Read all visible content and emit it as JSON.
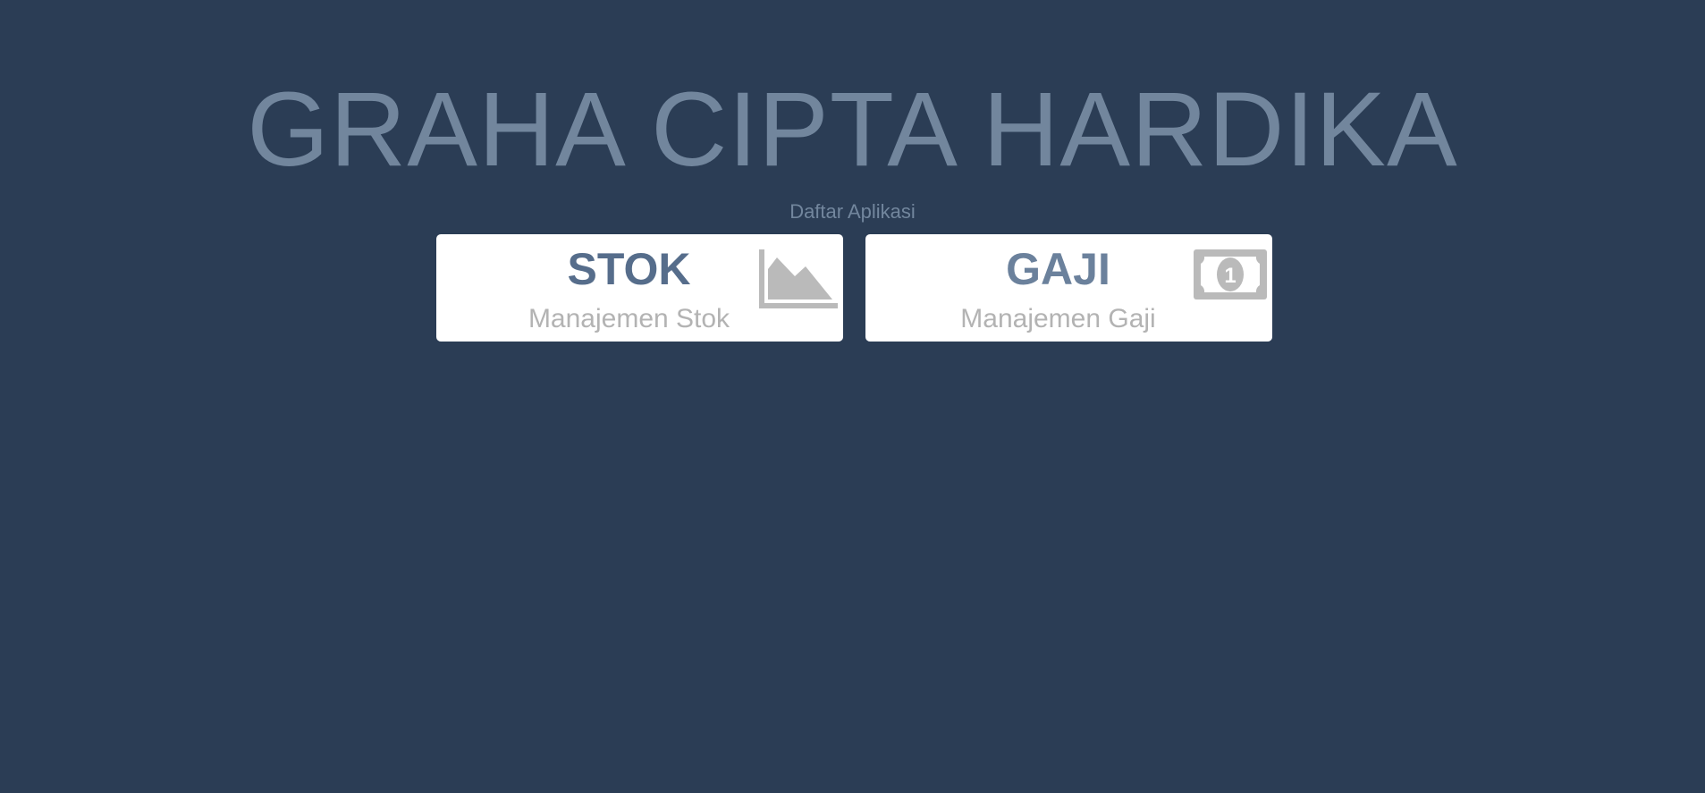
{
  "header": {
    "title": "GRAHA CIPTA HARDIKA",
    "subtitle": "Daftar Aplikasi"
  },
  "apps": [
    {
      "title": "STOK",
      "description": "Manajemen Stok",
      "icon": "area-chart-icon"
    },
    {
      "title": "GAJI",
      "description": "Manajemen Gaji",
      "icon": "money-bill-icon"
    }
  ],
  "colors": {
    "background": "#2b3d55",
    "title": "#72869d",
    "card": "#ffffff",
    "icon": "#bababa"
  }
}
